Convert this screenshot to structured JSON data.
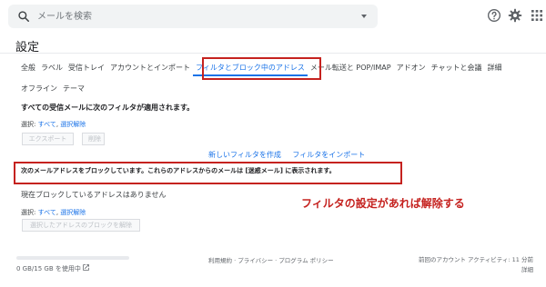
{
  "search": {
    "placeholder": "メールを検索"
  },
  "header": {
    "help_icon": "help-icon",
    "gear_icon": "gear-icon",
    "apps_icon": "apps-icon"
  },
  "page_title": "設定",
  "tabs": [
    {
      "label": "全般"
    },
    {
      "label": "ラベル"
    },
    {
      "label": "受信トレイ"
    },
    {
      "label": "アカウントとインポート"
    },
    {
      "label": "フィルタとブロック中のアドレス"
    },
    {
      "label": "メール転送と POP/IMAP"
    },
    {
      "label": "アドオン"
    },
    {
      "label": "チャットと会議"
    },
    {
      "label": "詳細"
    },
    {
      "label": "オフライン"
    },
    {
      "label": "テーマ"
    }
  ],
  "filters": {
    "heading": "すべての受信メールに次のフィルタが適用されます。",
    "select_label": "選択:",
    "select_all": "すべて",
    "select_none": "選択解除",
    "export_button": "エクスポート",
    "delete_button": "削除",
    "create_filter": "新しいフィルタを作成",
    "import_filter": "フィルタをインポート"
  },
  "blocked": {
    "heading": "次のメールアドレスをブロックしています。これらのアドレスからのメールは [迷惑メール] に表示されます。",
    "empty_text": "現在ブロックしているアドレスはありません",
    "select_label": "選択:",
    "select_all": "すべて",
    "select_none": "選択解除",
    "unblock_button": "選択したアドレスのブロックを解除"
  },
  "annotation": "フィルタの設定があれば解除する",
  "footer": {
    "storage_text": "0 GB/15 GB を使用中",
    "storage_fraction": 0.0,
    "links": "利用規約 · プライバシー · プログラム ポリシー",
    "last_activity": "前回のアカウント アクティビティ: 11 分前",
    "details": "詳細"
  },
  "colors": {
    "accent": "#1a73e8",
    "annotation_red": "#c5221f"
  }
}
